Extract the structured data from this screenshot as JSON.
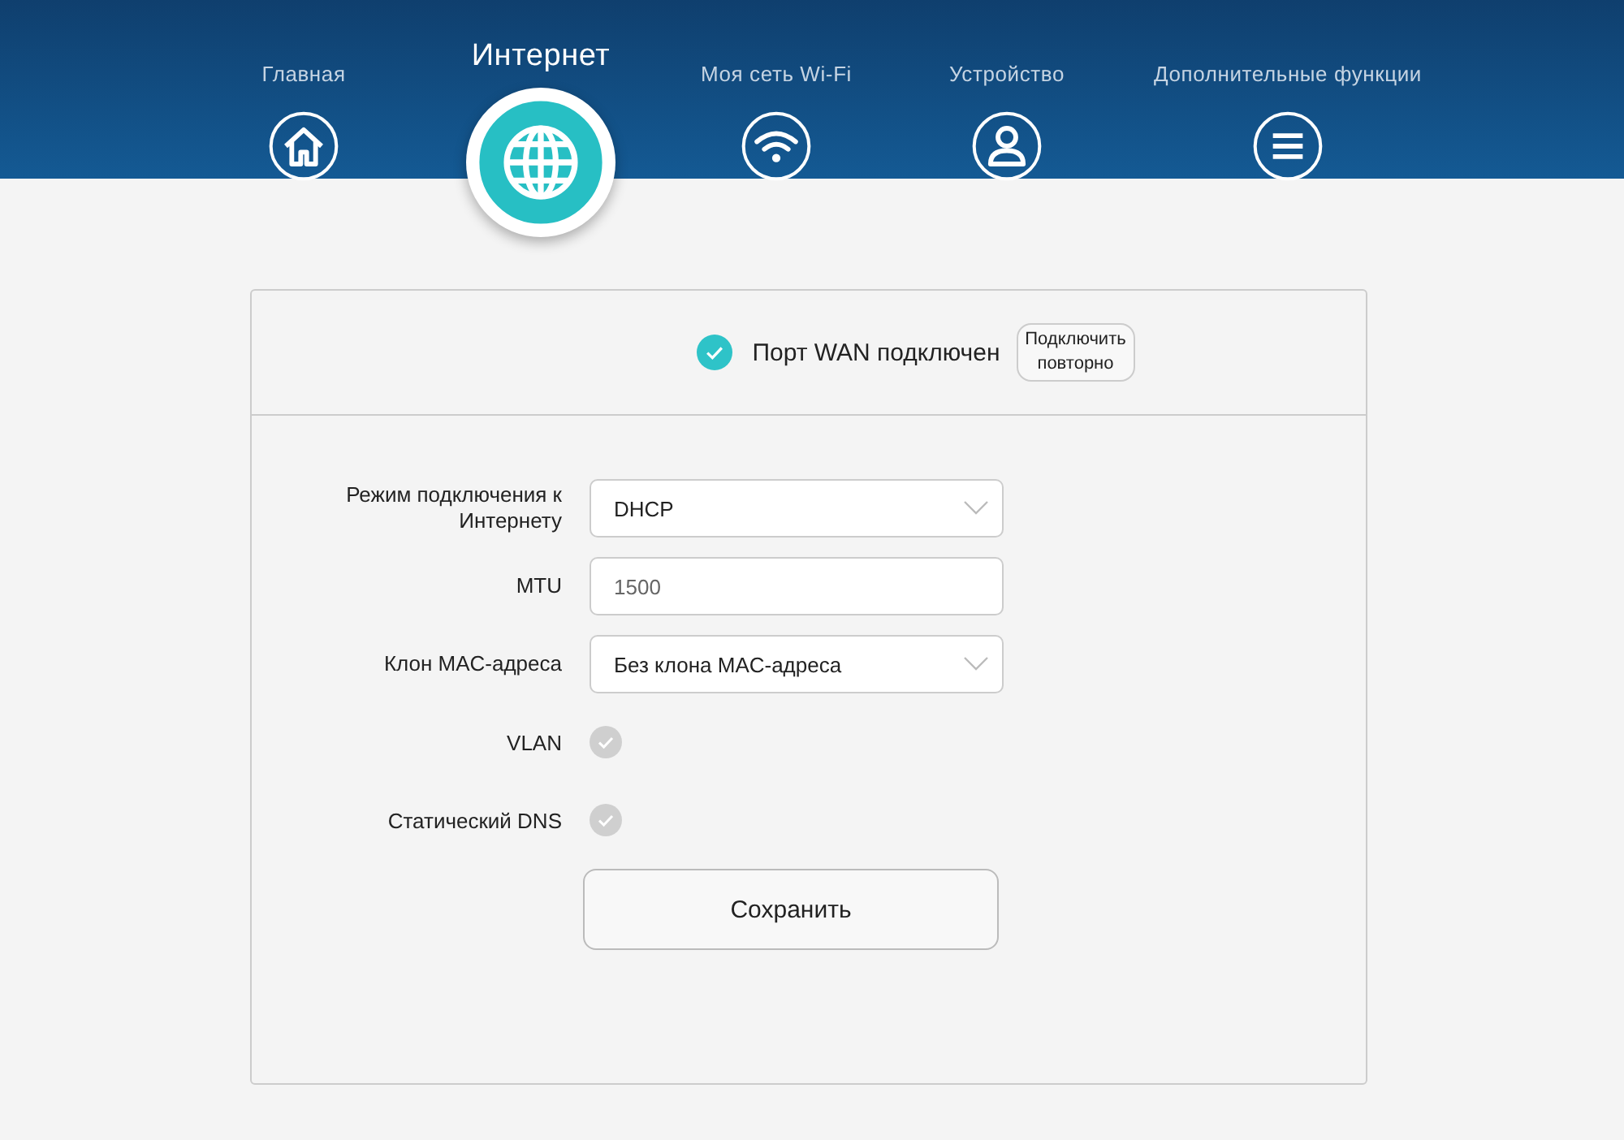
{
  "nav": [
    {
      "label": "Главная",
      "kind": "home",
      "selected": false
    },
    {
      "label": "Интернет",
      "kind": "globe",
      "selected": true
    },
    {
      "label": "Моя сеть Wi-Fi",
      "kind": "wifi",
      "selected": false
    },
    {
      "label": "Устройство",
      "kind": "person",
      "selected": false
    },
    {
      "label": "Дополнительные функции",
      "kind": "menu",
      "selected": false
    }
  ],
  "status": {
    "text": "Порт WAN подключен",
    "connected": true,
    "button": "Подключить повторно"
  },
  "fields": [
    {
      "kind": "select",
      "label": "Режим подключения к Интернету",
      "value": "DHCP"
    },
    {
      "kind": "input",
      "label": "MTU",
      "value": "1500"
    },
    {
      "kind": "select",
      "label": "Клон MAC-адреса",
      "value": "Без клона MAC-адреса"
    },
    {
      "kind": "toggle",
      "label": "VLAN",
      "checked": false
    },
    {
      "kind": "toggle",
      "label": "Статический DNS",
      "checked": false
    }
  ],
  "save_button": "Сохранить"
}
